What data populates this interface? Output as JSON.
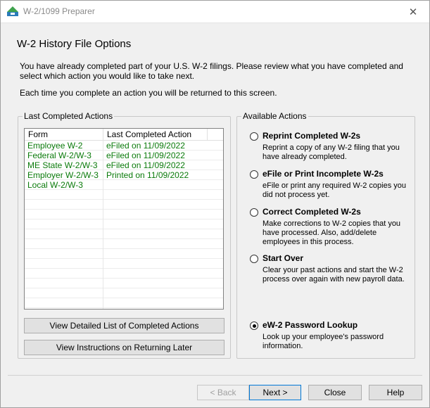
{
  "window": {
    "title": "W-2/1099 Preparer",
    "close_glyph": "✕"
  },
  "header": {
    "page_title": "W-2 History File Options",
    "intro": "You have already completed part of your U.S. W-2 filings. Please review what you have completed and select which action you would like to take next.",
    "intro2": "Each time you complete an action you will be returned to this screen."
  },
  "completed": {
    "legend": "Last Completed Actions",
    "columns": [
      "Form",
      "Last Completed Action"
    ],
    "rows": [
      {
        "form": "Employee W-2",
        "action": "eFiled on 11/09/2022"
      },
      {
        "form": "Federal W-2/W-3",
        "action": "eFiled on 11/09/2022"
      },
      {
        "form": "ME State W-2/W-3",
        "action": "eFiled on 11/09/2022"
      },
      {
        "form": "Employer W-2/W-3",
        "action": "Printed on 11/09/2022"
      },
      {
        "form": "Local W-2/W-3",
        "action": ""
      }
    ],
    "row_color": "#0a7a0a",
    "detailed_button": "View Detailed List of Completed Actions",
    "instructions_button": "View Instructions on Returning Later"
  },
  "available": {
    "legend": "Available Actions",
    "options": [
      {
        "label": "Reprint Completed W-2s",
        "desc": "Reprint a copy of any W-2 filing that you have already completed.",
        "checked": false
      },
      {
        "label": "eFile or Print Incomplete W-2s",
        "desc": "eFile or print any required W-2 copies you did not process yet.",
        "checked": false
      },
      {
        "label": "Correct Completed W-2s",
        "desc": "Make corrections to W-2 copies that you have processed. Also, add/delete employees in this process.",
        "checked": false
      },
      {
        "label": "Start Over",
        "desc": "Clear your past actions and start the W-2 process over again with new payroll data.",
        "checked": false
      },
      {
        "label": "eW-2 Password Lookup",
        "desc": "Look up your employee's password information.",
        "checked": true
      }
    ]
  },
  "footer": {
    "back": "< Back",
    "next": "Next >",
    "close": "Close",
    "help": "Help"
  }
}
